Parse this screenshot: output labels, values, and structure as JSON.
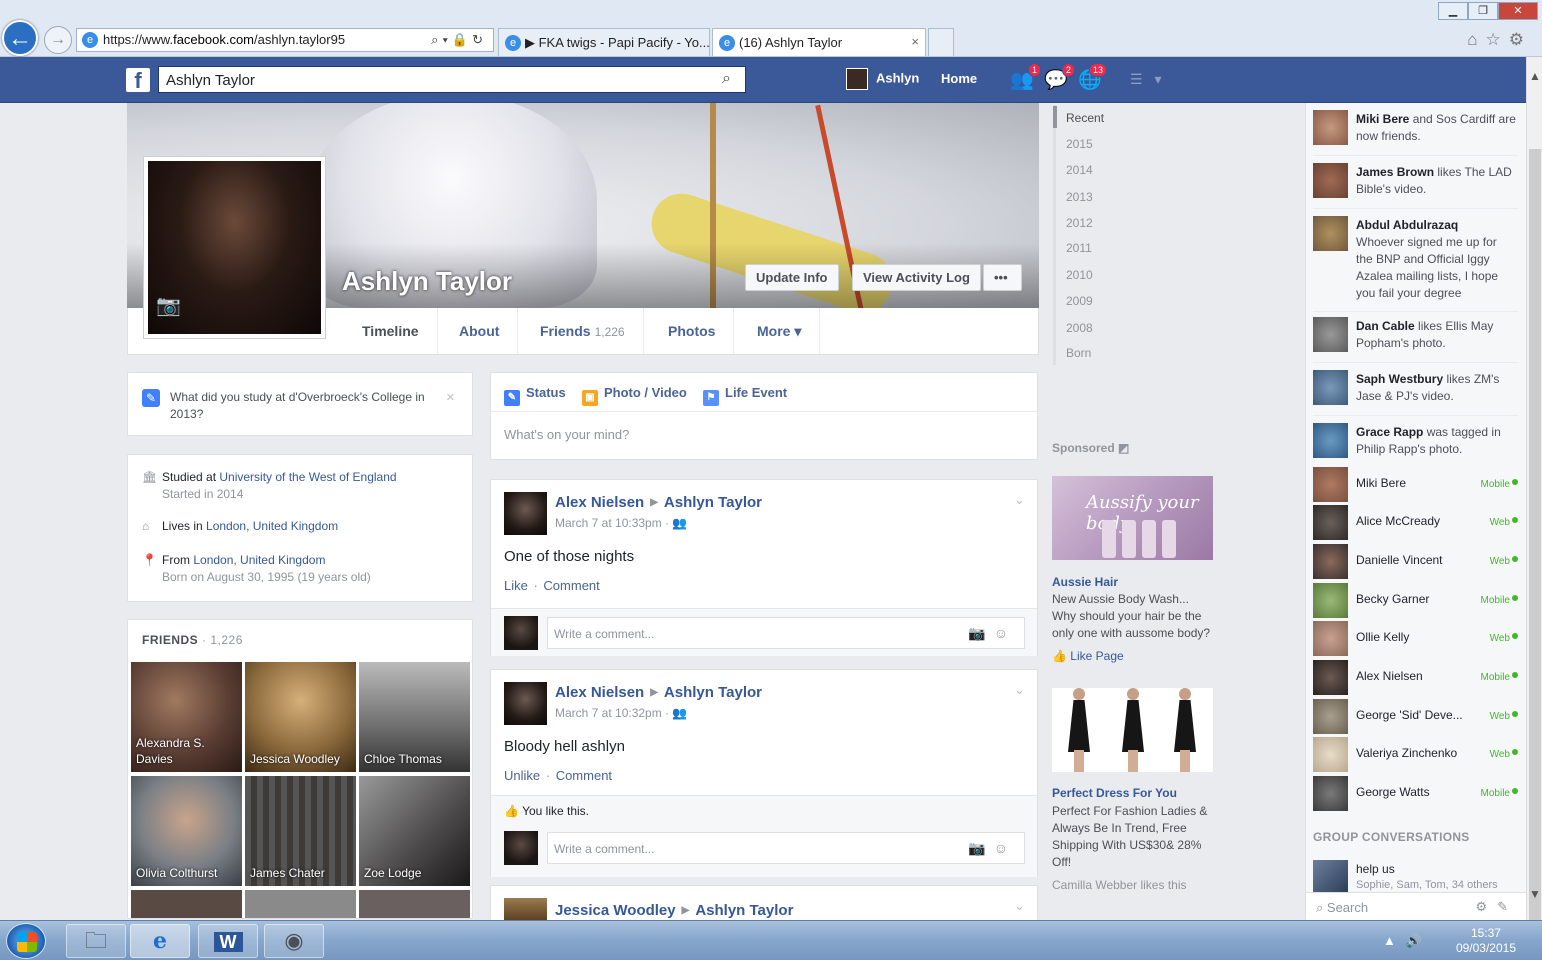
{
  "browser": {
    "url_prefix": "https://www.",
    "url_domain": "facebook.com",
    "url_path": "/ashlyn.taylor95",
    "tabs": [
      {
        "label": "▶ FKA twigs - Papi Pacify - Yo..."
      },
      {
        "label": "(16) Ashlyn Taylor",
        "close": "×"
      }
    ]
  },
  "fbbar": {
    "logo": "f",
    "search_value": "Ashlyn Taylor",
    "profile_name": "Ashlyn",
    "home_label": "Home",
    "badges": {
      "friends": "1",
      "messages": "2",
      "notifications": "13"
    }
  },
  "profile": {
    "name": "Ashlyn Taylor",
    "buttons": {
      "update_info": "Update Info",
      "activity_log": "View Activity Log",
      "more": "•••"
    },
    "tabs": [
      {
        "label": "Timeline"
      },
      {
        "label": "About"
      },
      {
        "label": "Friends",
        "count": "1,226"
      },
      {
        "label": "Photos"
      },
      {
        "label": "More ▾"
      }
    ]
  },
  "study_prompt": {
    "question": "What did you study at d'Overbroeck's College in 2013?",
    "close": "×"
  },
  "intro": {
    "studied_prefix": "Studied at ",
    "studied_school": "University of the West of England",
    "studied_sub": "Started in 2014",
    "lives_prefix": "Lives in ",
    "lives_place": "London, United Kingdom",
    "from_prefix": "From ",
    "from_place": "London, United Kingdom",
    "born": "Born on August 30, 1995 (19 years old)"
  },
  "friends": {
    "header": "FRIENDS",
    "count": "· 1,226",
    "tiles": [
      {
        "name": "Alexandra S. Davies",
        "color": "#5a3d33"
      },
      {
        "name": "Jessica Woodley",
        "color": "#8c6a3c"
      },
      {
        "name": "Chloe Thomas",
        "color": "#6d6d6d"
      },
      {
        "name": "Olivia Colthurst",
        "color": "#7a7f86"
      },
      {
        "name": "James Chater",
        "color": "#3d3a38"
      },
      {
        "name": "Zoe Lodge",
        "color": "#4a4848"
      }
    ]
  },
  "composer": {
    "status": "Status",
    "photo_video": "Photo / Video",
    "life_event": "Life Event",
    "placeholder": "What's on your mind?"
  },
  "posts": [
    {
      "author": "Alex Nielsen",
      "target": "Ashlyn Taylor",
      "time": "March 7 at 10:33pm",
      "text": "One of those nights",
      "like": "Like",
      "comment": "Comment",
      "comment_placeholder": "Write a comment..."
    },
    {
      "author": "Alex Nielsen",
      "target": "Ashlyn Taylor",
      "time": "March 7 at 10:32pm",
      "text": "Bloody hell ashlyn",
      "like": "Unlike",
      "comment": "Comment",
      "likes_line": "You like this.",
      "comment_placeholder": "Write a comment..."
    },
    {
      "author": "Jessica Woodley",
      "target": "Ashlyn Taylor"
    }
  ],
  "timeline_years": [
    "Recent",
    "2015",
    "2014",
    "2013",
    "2012",
    "2011",
    "2010",
    "2009",
    "2008",
    "Born"
  ],
  "sponsored": {
    "label": "Sponsored",
    "ad1": {
      "logo": "Aussify your body",
      "title": "Aussie Hair",
      "text": "New Aussie Body Wash... Why should your hair be the only one with aussome body?",
      "like": "Like Page"
    },
    "ad2": {
      "title": "Perfect Dress For You",
      "text": "Perfect For Fashion Ladies & Always Be In Trend, Free Shipping With US$30& 28% Off!",
      "social": "Camilla Webber likes this"
    }
  },
  "ticker": [
    {
      "name": "Miki Bere",
      "text": " and Sos Cardiff are now friends.",
      "color": "#8a5a48"
    },
    {
      "name": "James Brown",
      "text": " likes The LAD Bible's video.",
      "color": "#6a4234"
    },
    {
      "name": "Abdul Abdulrazaq",
      "text": " Whoever signed me up for the BNP and Official Iggy Azalea mailing lists, I hope you fail your degree",
      "color": "#705a3e"
    },
    {
      "name": "Dan Cable",
      "text": " likes Ellis May Popham's photo.",
      "color": "#5b5b5b"
    },
    {
      "name": "Saph Westbury",
      "text": " likes ZM's Jase & PJ's video.",
      "color": "#3e5a7a"
    },
    {
      "name": "Grace Rapp",
      "text": " was tagged in Philip Rapp's photo.",
      "color": "#2e5a82"
    }
  ],
  "chat_friends": [
    {
      "name": "Miki Bere",
      "status": "Mobile",
      "color": "#7a5040"
    },
    {
      "name": "Alice McCready",
      "status": "Web",
      "color": "#2e2a28"
    },
    {
      "name": "Danielle Vincent",
      "status": "Web",
      "color": "#3a3030"
    },
    {
      "name": "Becky Garner",
      "status": "Mobile",
      "color": "#5a7a3a"
    },
    {
      "name": "Ollie Kelly",
      "status": "Web",
      "color": "#8a6a5a"
    },
    {
      "name": "Alex Nielsen",
      "status": "Mobile",
      "color": "#2a2220"
    },
    {
      "name": "George 'Sid' Deve...",
      "status": "Web",
      "color": "#6a6050"
    },
    {
      "name": "Valeriya Zinchenko",
      "status": "Web",
      "color": "#b8a890"
    },
    {
      "name": "George Watts",
      "status": "Mobile",
      "color": "#3a3a3a"
    }
  ],
  "group": {
    "header": "GROUP CONVERSATIONS",
    "name": "help us",
    "members": "Sophie, Sam, Tom, 34 others"
  },
  "chat_search": "Search",
  "taskbar": {
    "time": "15:37",
    "date": "09/03/2015"
  },
  "colors": {
    "fb_blue": "#3b5998",
    "link": "#365899",
    "online": "#42b72a",
    "badge": "#f02849"
  }
}
